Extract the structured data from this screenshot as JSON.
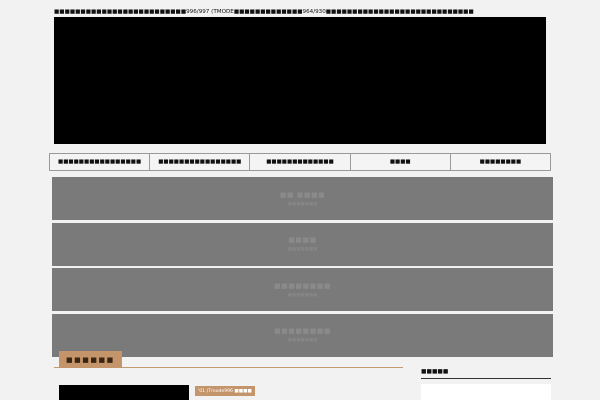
{
  "site_description": "■■■■■■■■■■■■■■■■■■■■■■■■■996/997 (TMODE■■■■■■■■■■■■■964/930■■■■■■■■■■■■■■■■■■■■■■■■■■■■",
  "nav": {
    "items": [
      {
        "label": "■■■■■■■■■■■■■■■■"
      },
      {
        "label": "■■■■■■■■■■■■■■■■"
      },
      {
        "label": "■■■■■■■■■■■■■"
      },
      {
        "label": "■■■■"
      },
      {
        "label": "■■■■■■■■"
      }
    ]
  },
  "banners": [
    {
      "title": "■■ ■■■■",
      "subtitle": "■■■■■■■"
    },
    {
      "title": "■■■■",
      "subtitle": "■■■■■■■"
    },
    {
      "title": "■■■■■■■■",
      "subtitle": "■■■■■■■"
    },
    {
      "title": "■■■■■■■■",
      "subtitle": "■■■■■■■"
    }
  ],
  "main": {
    "section_heading": "■■■■■■",
    "post": {
      "category": "'01 (Tmode996 ■■■■"
    }
  },
  "sidebar": {
    "title": "■■■■■"
  },
  "colors": {
    "background": "#f2f2f2",
    "accent": "#c4956a",
    "banner": "#7a7a7a"
  }
}
